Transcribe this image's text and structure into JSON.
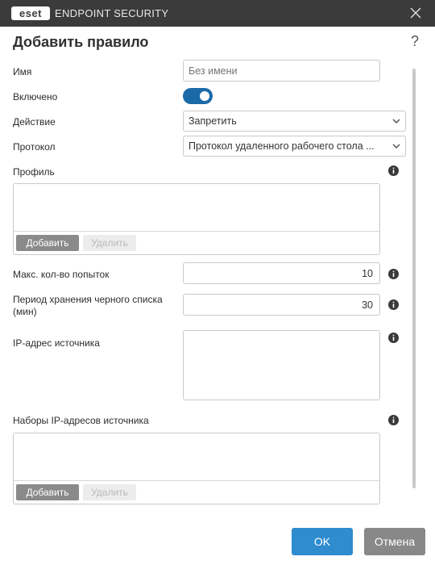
{
  "window": {
    "logo_text": "eset",
    "product_name": "ENDPOINT SECURITY",
    "close_icon": "close-icon"
  },
  "dialog": {
    "title": "Добавить правило",
    "help_glyph": "?"
  },
  "form": {
    "name_label": "Имя",
    "name_placeholder": "Без имени",
    "enabled_label": "Включено",
    "enabled_value": true,
    "action_label": "Действие",
    "action_value": "Запретить",
    "protocol_label": "Протокол",
    "protocol_value": "Протокол удаленного рабочего стола ...",
    "profile_label": "Профиль",
    "max_attempts_label": "Макс. кол-во попыток",
    "max_attempts_value": "10",
    "blacklist_period_label": "Период хранения черного списка (мин)",
    "blacklist_period_value": "30",
    "source_ip_label": "IP-адрес источника",
    "source_ip_sets_label": "Наборы IP-адресов источника",
    "add_label": "Добавить",
    "delete_label": "Удалить"
  },
  "buttons": {
    "ok": "OK",
    "cancel": "Отмена"
  },
  "colors": {
    "titlebar": "#3b3b3c",
    "toggle_on": "#1b6aa8",
    "ok_button": "#2e8ccf",
    "cancel_button": "#888888"
  }
}
